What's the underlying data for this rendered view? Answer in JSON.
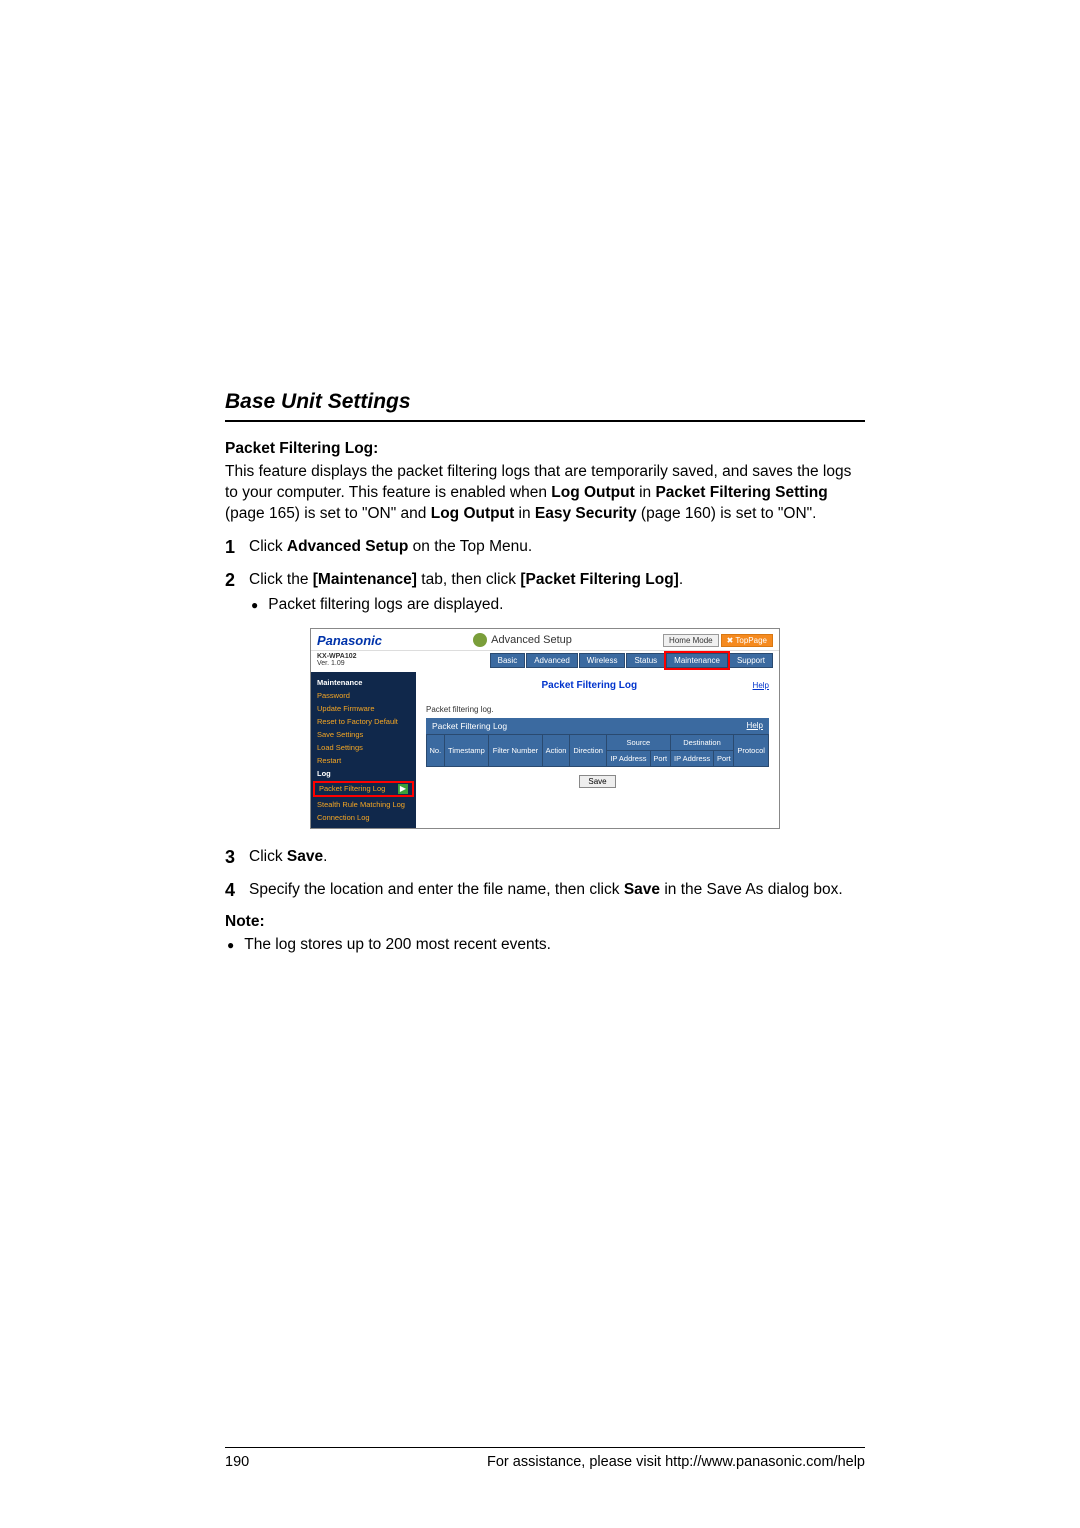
{
  "section_title": "Base Unit Settings",
  "feature": {
    "heading": "Packet Filtering Log:",
    "body_parts": [
      "This feature displays the packet filtering logs that are temporarily saved, and saves the logs to your computer. This feature is enabled when ",
      "Log Output",
      " in ",
      "Packet Filtering Setting",
      " (page 165) is set to \"ON\" and ",
      "Log Output",
      " in ",
      "Easy Security",
      " (page 160) is set to \"ON\"."
    ]
  },
  "steps": {
    "s1": {
      "num": "1",
      "parts": [
        "Click ",
        "Advanced Setup",
        " on the Top Menu."
      ]
    },
    "s2": {
      "num": "2",
      "parts": [
        "Click the ",
        "[Maintenance]",
        " tab, then click ",
        "[Packet Filtering Log]",
        "."
      ],
      "bullet": "Packet filtering logs are displayed."
    },
    "s3": {
      "num": "3",
      "parts": [
        "Click ",
        "Save",
        "."
      ]
    },
    "s4": {
      "num": "4",
      "parts": [
        "Specify the location and enter the file name, then click ",
        "Save",
        " in the Save As dialog box."
      ]
    }
  },
  "note": {
    "heading": "Note:",
    "bullet": "The log stores up to 200 most recent events."
  },
  "screenshot": {
    "brand": "Panasonic",
    "adv_setup": "Advanced Setup",
    "home_mode": "Home Mode",
    "top_page": "TopPage",
    "model": "KX-WPA102",
    "ver": "Ver. 1.09",
    "tabs": [
      "Basic",
      "Advanced",
      "Wireless",
      "Status",
      "Maintenance",
      "Support"
    ],
    "sidebar": {
      "head1": "Maintenance",
      "items1": [
        "Password",
        "Update Firmware",
        "Reset to Factory Default",
        "Save Settings",
        "Load Settings",
        "Restart"
      ],
      "head2": "Log",
      "items2": [
        "Packet Filtering Log",
        "Stealth Rule Matching Log",
        "Connection Log"
      ]
    },
    "panel": {
      "title": "Packet Filtering Log",
      "help": "Help",
      "small_label": "Packet filtering log.",
      "subtitle": "Packet Filtering Log",
      "cols": [
        "No.",
        "Timestamp",
        "Filter Number",
        "Action",
        "Direction"
      ],
      "group_source": "Source",
      "group_dest": "Destination",
      "sub_cols": [
        "IP Address",
        "Port",
        "IP Address",
        "Port"
      ],
      "protocol": "Protocol",
      "save": "Save"
    }
  },
  "footer": {
    "page_num": "190",
    "assist": "For assistance, please visit http://www.panasonic.com/help"
  }
}
